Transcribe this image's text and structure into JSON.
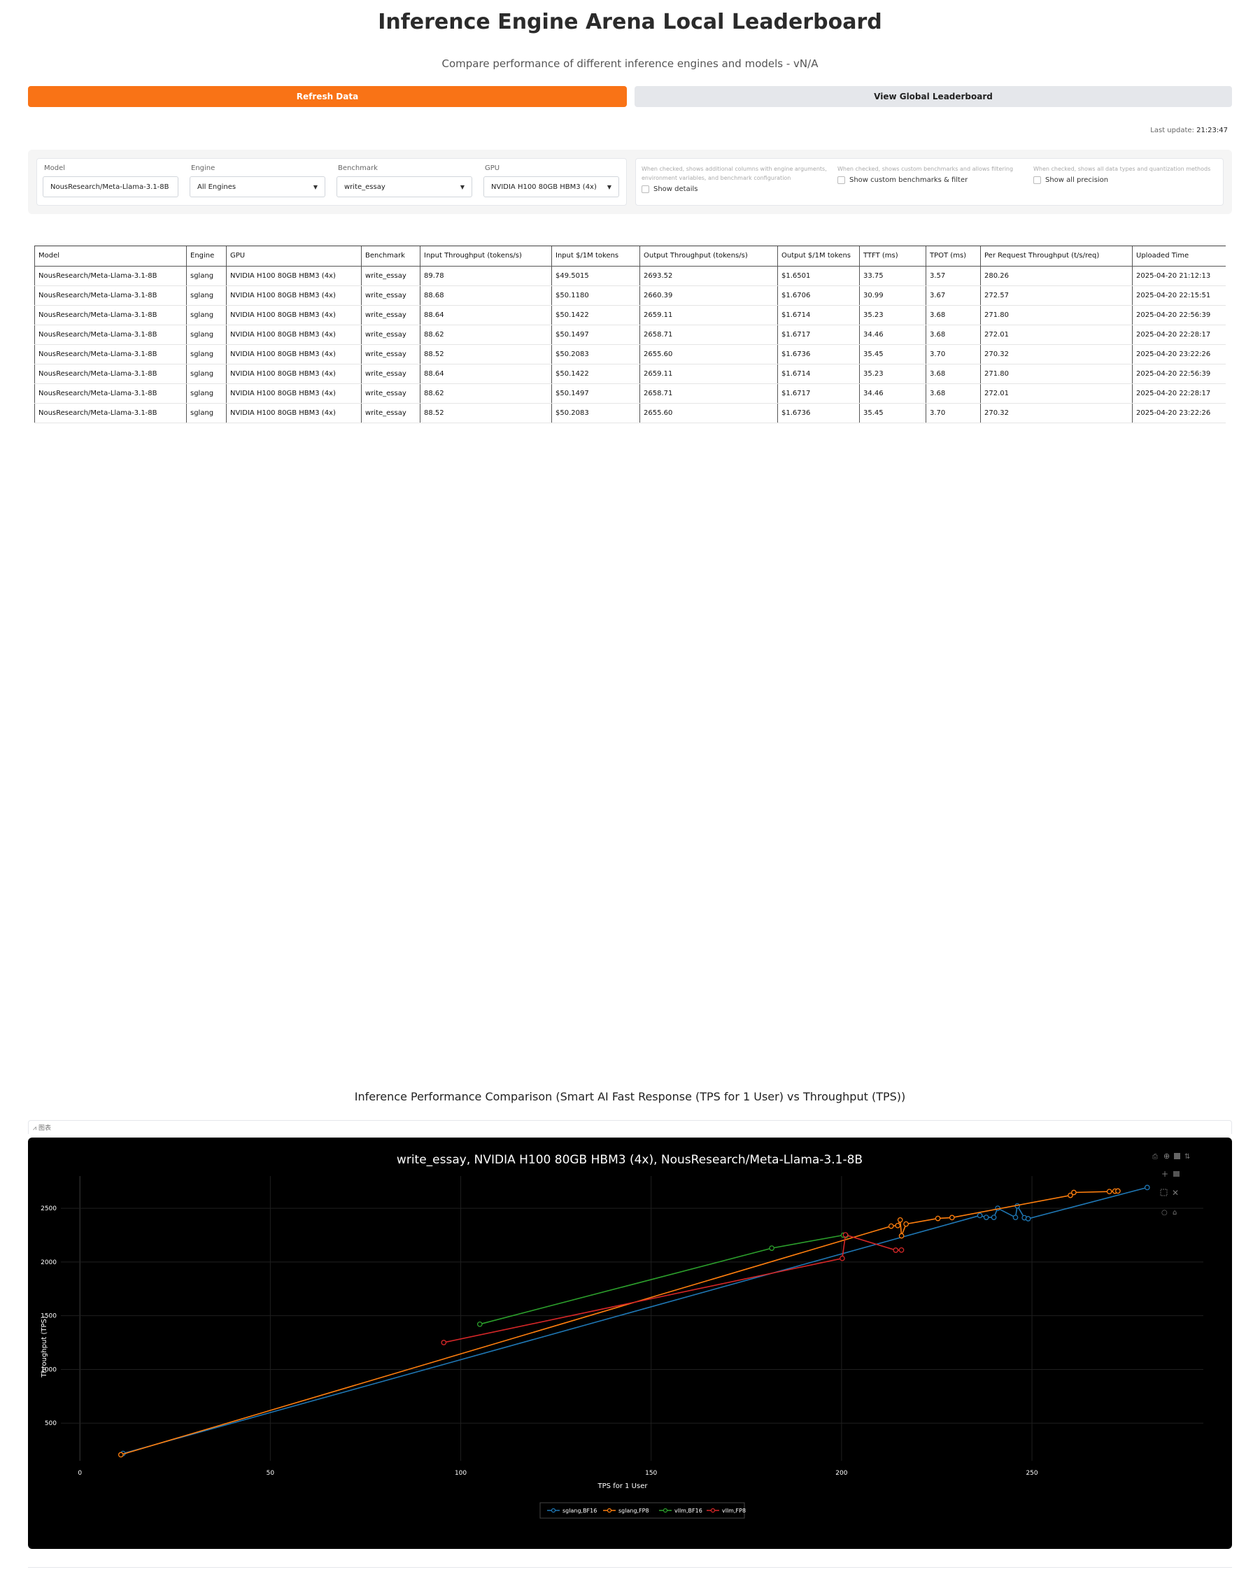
{
  "header": {
    "title": "Inference Engine Arena Local Leaderboard",
    "subtitle": "Compare performance of different inference engines and models - vN/A"
  },
  "buttons": {
    "refresh": "Refresh Data",
    "global": "View Global Leaderboard"
  },
  "last_update": {
    "label": "Last update: ",
    "value": "21:23:47"
  },
  "filters": {
    "model": {
      "label": "Model",
      "value": "NousResearch/Meta-Llama-3.1-8B"
    },
    "engine": {
      "label": "Engine",
      "value": "All Engines"
    },
    "benchmark": {
      "label": "Benchmark",
      "value": "write_essay"
    },
    "gpu": {
      "label": "GPU",
      "value": "NVIDIA H100 80GB HBM3 (4x)"
    },
    "show_details": {
      "info": "When checked, shows additional columns with engine arguments, environment variables, and benchmark configuration",
      "label": "Show details"
    },
    "custom_benchmarks": {
      "info": "When checked, shows custom benchmarks and allows filtering",
      "label": "Show custom benchmarks & filter"
    },
    "all_precision": {
      "info": "When checked, shows all data types and quantization methods",
      "label": "Show all precision"
    }
  },
  "table": {
    "columns": [
      "Model",
      "Engine",
      "GPU",
      "Benchmark",
      "Input Throughput (tokens/s)",
      "Input $/1M tokens",
      "Output Throughput (tokens/s)",
      "Output $/1M tokens",
      "TTFT (ms)",
      "TPOT (ms)",
      "Per Request Throughput (t/s/req)",
      "Uploaded Time"
    ],
    "rows": [
      [
        "NousResearch/Meta-Llama-3.1-8B",
        "sglang",
        "NVIDIA H100 80GB HBM3 (4x)",
        "write_essay",
        "89.78",
        "$49.5015",
        "2693.52",
        "$1.6501",
        "33.75",
        "3.57",
        "280.26",
        "2025-04-20 21:12:13"
      ],
      [
        "NousResearch/Meta-Llama-3.1-8B",
        "sglang",
        "NVIDIA H100 80GB HBM3 (4x)",
        "write_essay",
        "88.68",
        "$50.1180",
        "2660.39",
        "$1.6706",
        "30.99",
        "3.67",
        "272.57",
        "2025-04-20 22:15:51"
      ],
      [
        "NousResearch/Meta-Llama-3.1-8B",
        "sglang",
        "NVIDIA H100 80GB HBM3 (4x)",
        "write_essay",
        "88.64",
        "$50.1422",
        "2659.11",
        "$1.6714",
        "35.23",
        "3.68",
        "271.80",
        "2025-04-20 22:56:39"
      ],
      [
        "NousResearch/Meta-Llama-3.1-8B",
        "sglang",
        "NVIDIA H100 80GB HBM3 (4x)",
        "write_essay",
        "88.62",
        "$50.1497",
        "2658.71",
        "$1.6717",
        "34.46",
        "3.68",
        "272.01",
        "2025-04-20 22:28:17"
      ],
      [
        "NousResearch/Meta-Llama-3.1-8B",
        "sglang",
        "NVIDIA H100 80GB HBM3 (4x)",
        "write_essay",
        "88.52",
        "$50.2083",
        "2655.60",
        "$1.6736",
        "35.45",
        "3.70",
        "270.32",
        "2025-04-20 23:22:26"
      ],
      [
        "NousResearch/Meta-Llama-3.1-8B",
        "sglang",
        "NVIDIA H100 80GB HBM3 (4x)",
        "write_essay",
        "88.64",
        "$50.1422",
        "2659.11",
        "$1.6714",
        "35.23",
        "3.68",
        "271.80",
        "2025-04-20 22:56:39"
      ],
      [
        "NousResearch/Meta-Llama-3.1-8B",
        "sglang",
        "NVIDIA H100 80GB HBM3 (4x)",
        "write_essay",
        "88.62",
        "$50.1497",
        "2658.71",
        "$1.6717",
        "34.46",
        "3.68",
        "272.01",
        "2025-04-20 22:28:17"
      ],
      [
        "NousResearch/Meta-Llama-3.1-8B",
        "sglang",
        "NVIDIA H100 80GB HBM3 (4x)",
        "write_essay",
        "88.52",
        "$50.2083",
        "2655.60",
        "$1.6736",
        "35.45",
        "3.70",
        "270.32",
        "2025-04-20 23:22:26"
      ]
    ]
  },
  "chart_section_title": "Inference Performance Comparison (Smart AI Fast Response (TPS for 1 User) vs Throughput (TPS))",
  "chart_tab_label": "图表",
  "chart_data": {
    "type": "scatter",
    "title": "write_essay, NVIDIA H100 80GB HBM3 (4x), NousResearch/Meta-Llama-3.1-8B",
    "xlabel": "TPS for 1 User",
    "ylabel": "Throughput (TPS)",
    "xlim": [
      -5,
      295
    ],
    "ylim": [
      150,
      2800
    ],
    "xticks": [
      0,
      50,
      100,
      150,
      200,
      250
    ],
    "yticks": [
      500,
      1000,
      1500,
      2000,
      2500
    ],
    "grid": true,
    "legend": "bottom-center",
    "series": [
      {
        "name": "sglang,BF16",
        "color": "#1f77b4",
        "points": [
          [
            11.32,
            217.56
          ],
          [
            236.33,
            2433.08
          ],
          [
            238.0,
            2415.0
          ],
          [
            240.0,
            2415.0
          ],
          [
            241.0,
            2500.0
          ],
          [
            245.68,
            2414.65
          ],
          [
            246.16,
            2521.7
          ],
          [
            248.0,
            2412.0
          ],
          [
            249.0,
            2403.0
          ],
          [
            280.26,
            2693.52
          ]
        ]
      },
      {
        "name": "sglang,FP8",
        "color": "#ff7f0e",
        "points": [
          [
            10.76,
            205.97
          ],
          [
            213.03,
            2333.93
          ],
          [
            214.76,
            2339.17
          ],
          [
            215.39,
            2390.89
          ],
          [
            215.75,
            2243.51
          ],
          [
            216.95,
            2353.26
          ],
          [
            225.3,
            2405.62
          ],
          [
            229.01,
            2413.33
          ],
          [
            260.1,
            2620.44
          ],
          [
            261.0,
            2647.02
          ],
          [
            270.32,
            2655.6
          ],
          [
            271.8,
            2659.11
          ],
          [
            272.57,
            2660.39
          ]
        ]
      },
      {
        "name": "vllm,BF16",
        "color": "#2ca02c",
        "points": [
          [
            105.0,
            1421.08
          ],
          [
            181.67,
            2128.82
          ],
          [
            200.49,
            2249.6
          ],
          [
            201.15,
            2246.6
          ]
        ]
      },
      {
        "name": "vllm,FP8",
        "color": "#d62728",
        "points": [
          [
            95.55,
            1250.31
          ],
          [
            200.19,
            2033.59
          ],
          [
            214.22,
            2110.09
          ],
          [
            215.73,
            2110.96
          ],
          [
            201.03,
            2252.15
          ]
        ]
      }
    ]
  }
}
